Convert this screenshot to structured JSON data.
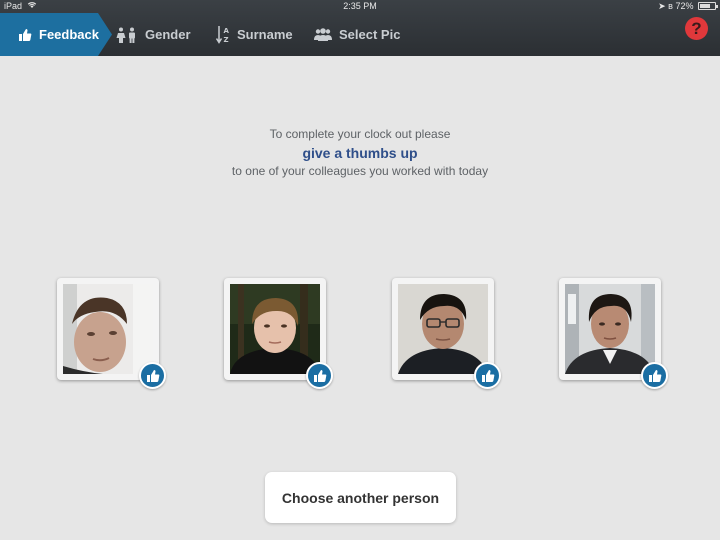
{
  "status_bar": {
    "carrier": "iPad",
    "time": "2:35 PM",
    "battery": "72%",
    "battery_level": 0.72
  },
  "nav": {
    "tabs": [
      {
        "label": "Feedback",
        "icon": "thumbs-up-icon",
        "active": true
      },
      {
        "label": "Gender",
        "icon": "gender-icon",
        "active": false
      },
      {
        "label": "Surname",
        "icon": "sort-az-icon",
        "active": false
      },
      {
        "label": "Select Pic",
        "icon": "group-icon",
        "active": false
      }
    ],
    "help_label": "?"
  },
  "instructions": {
    "line1": "To complete your clock out please",
    "line2": "give a thumbs up",
    "line3": "to one of your colleagues you worked with today"
  },
  "people": [
    {
      "photo": "colleague-photo-1"
    },
    {
      "photo": "colleague-photo-2"
    },
    {
      "photo": "colleague-photo-3"
    },
    {
      "photo": "colleague-photo-4"
    }
  ],
  "actions": {
    "choose_label": "Choose another person"
  },
  "colors": {
    "accent": "#1d6fa0",
    "header": "#2f3438",
    "help": "#e0383b",
    "highlight_text": "#2f4f8a",
    "background": "#e6e6e6"
  }
}
